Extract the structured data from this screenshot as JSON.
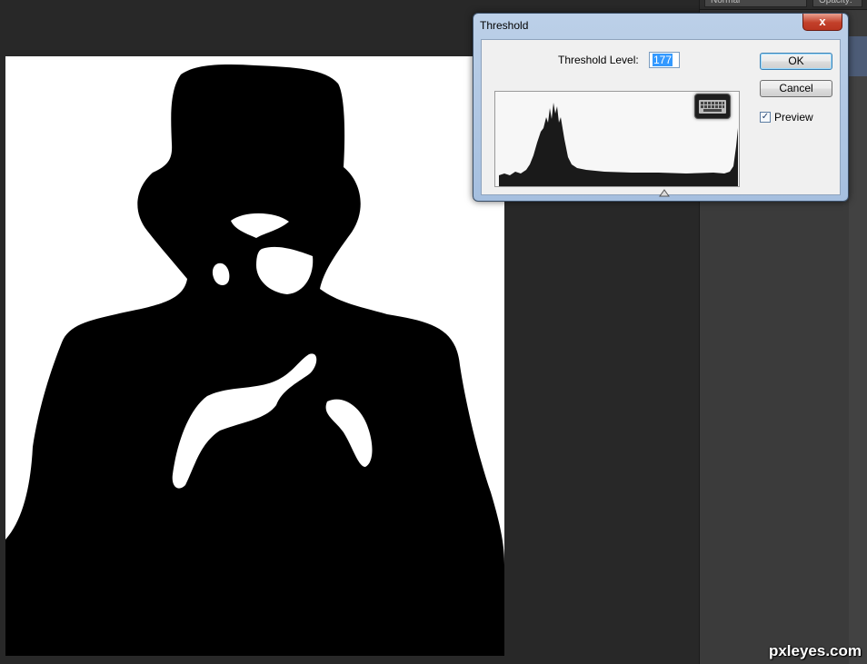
{
  "dialog": {
    "title": "Threshold",
    "close_label": "x",
    "threshold_label": "Threshold Level:",
    "threshold_value": "177",
    "ok_label": "OK",
    "cancel_label": "Cancel",
    "preview_label": "Preview",
    "preview_checked": true,
    "preview_check_glyph": "✓"
  },
  "panel": {
    "blend_mode": "Normal",
    "opacity_label": "Opacity:"
  },
  "icons": {
    "keyboard": "keyboard-icon",
    "close": "close-icon",
    "slider": "threshold-slider-icon"
  },
  "watermark": "pxleyes.com",
  "colors": {
    "workspace": "#282828",
    "panel": "#3b3b3b",
    "dialog_frame": "#a5bfdf",
    "close_button": "#c2402a",
    "selection": "#3399ff"
  }
}
